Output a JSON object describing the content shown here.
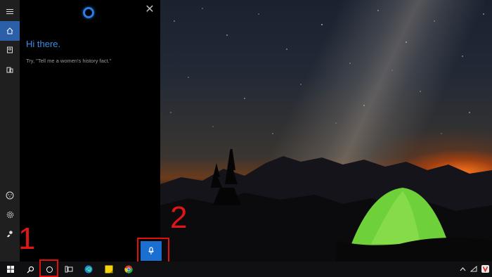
{
  "cortana": {
    "greeting": "Hi there.",
    "prompt": "Try, \"Tell me a women's history fact.\"",
    "close_glyph": "✕"
  },
  "annotations": {
    "step1": "1",
    "step2": "2"
  },
  "colors": {
    "accent": "#2b5fa8",
    "greeting": "#3a8ee6",
    "highlight": "#e01010"
  },
  "icons": {
    "rail": [
      "hamburger-icon",
      "home-icon",
      "notebook-icon",
      "devices-icon",
      "feedback-icon",
      "settings-icon",
      "account-icon"
    ],
    "taskbar": [
      "windows-icon",
      "search-icon",
      "cortana-icon",
      "task-view-icon",
      "edge-icon",
      "sticky-notes-icon",
      "chrome-icon"
    ],
    "tray": [
      "chevron-up-icon",
      "network-icon",
      "vivaldi-icon"
    ]
  }
}
